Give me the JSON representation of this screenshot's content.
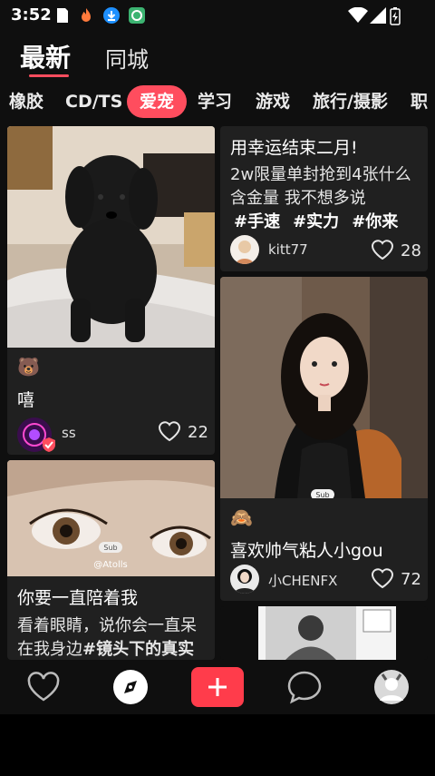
{
  "status_bar": {
    "time": "3:52"
  },
  "header": {
    "tabs": [
      {
        "label": "最新",
        "active": true
      },
      {
        "label": "同城",
        "active": false
      }
    ]
  },
  "categories": [
    {
      "label": "橡胶",
      "active": false
    },
    {
      "label": "CD/TS",
      "active": false
    },
    {
      "label": "爱宠",
      "active": true
    },
    {
      "label": "学习",
      "active": false
    },
    {
      "label": "游戏",
      "active": false
    },
    {
      "label": "旅行/摄影",
      "active": false
    },
    {
      "label": "职",
      "active": false
    }
  ],
  "cards": {
    "dog": {
      "emoji": "🐻",
      "title": "嘻",
      "username": "ss",
      "likes": "22"
    },
    "text_post": {
      "title": "用幸运结束二月!",
      "body": "2w限量单封抢到4张什么含金量 我不想多说",
      "tags": [
        "#手速",
        "#实力",
        "#你来"
      ],
      "username": "kitt77",
      "likes": "28"
    },
    "girl": {
      "badge": "Sub",
      "emoji": "🙈",
      "title": "喜欢帅气粘人小gou",
      "username": "小CHENFX",
      "likes": "72"
    },
    "eyes": {
      "watermark_badge": "Sub",
      "watermark_handle": "@Atolls",
      "title": "你要一直陪着我",
      "body_prefix": "看着眼睛，说你会一直呆在我身边",
      "body_tag": "#镜头下的真实"
    }
  },
  "bottom_nav": [
    {
      "icon": "heart-icon"
    },
    {
      "icon": "compass-icon",
      "active": true
    },
    {
      "icon": "plus-icon"
    },
    {
      "icon": "chat-bubble-icon"
    },
    {
      "icon": "profile-avatar-icon"
    }
  ],
  "colors": {
    "accent": "#ff4d5e",
    "background": "#0f0f0f",
    "card": "#202020"
  }
}
